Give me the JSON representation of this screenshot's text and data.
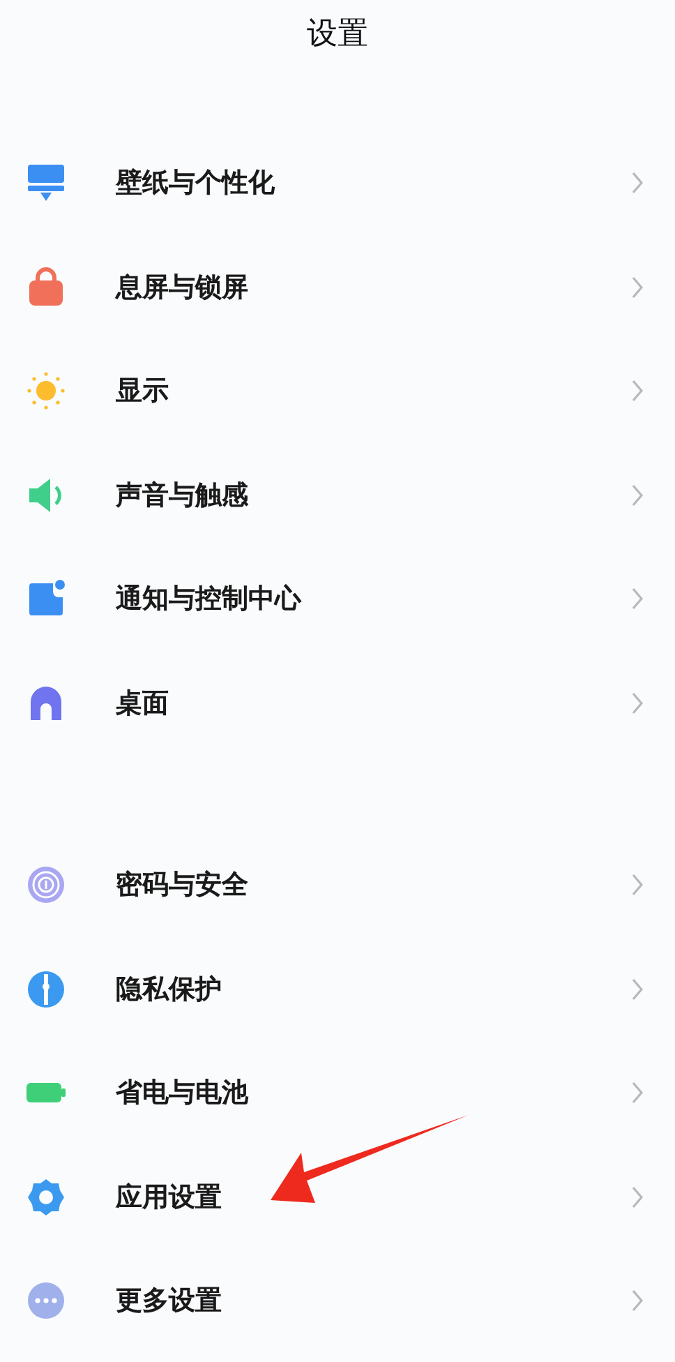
{
  "title": "设置",
  "sections": [
    {
      "items": [
        {
          "label": "壁纸与个性化"
        },
        {
          "label": "息屏与锁屏"
        },
        {
          "label": "显示"
        },
        {
          "label": "声音与触感"
        },
        {
          "label": "通知与控制中心"
        },
        {
          "label": "桌面"
        }
      ]
    },
    {
      "items": [
        {
          "label": "密码与安全"
        },
        {
          "label": "隐私保护"
        },
        {
          "label": "省电与电池"
        },
        {
          "label": "应用设置"
        },
        {
          "label": "更多设置"
        }
      ]
    }
  ]
}
